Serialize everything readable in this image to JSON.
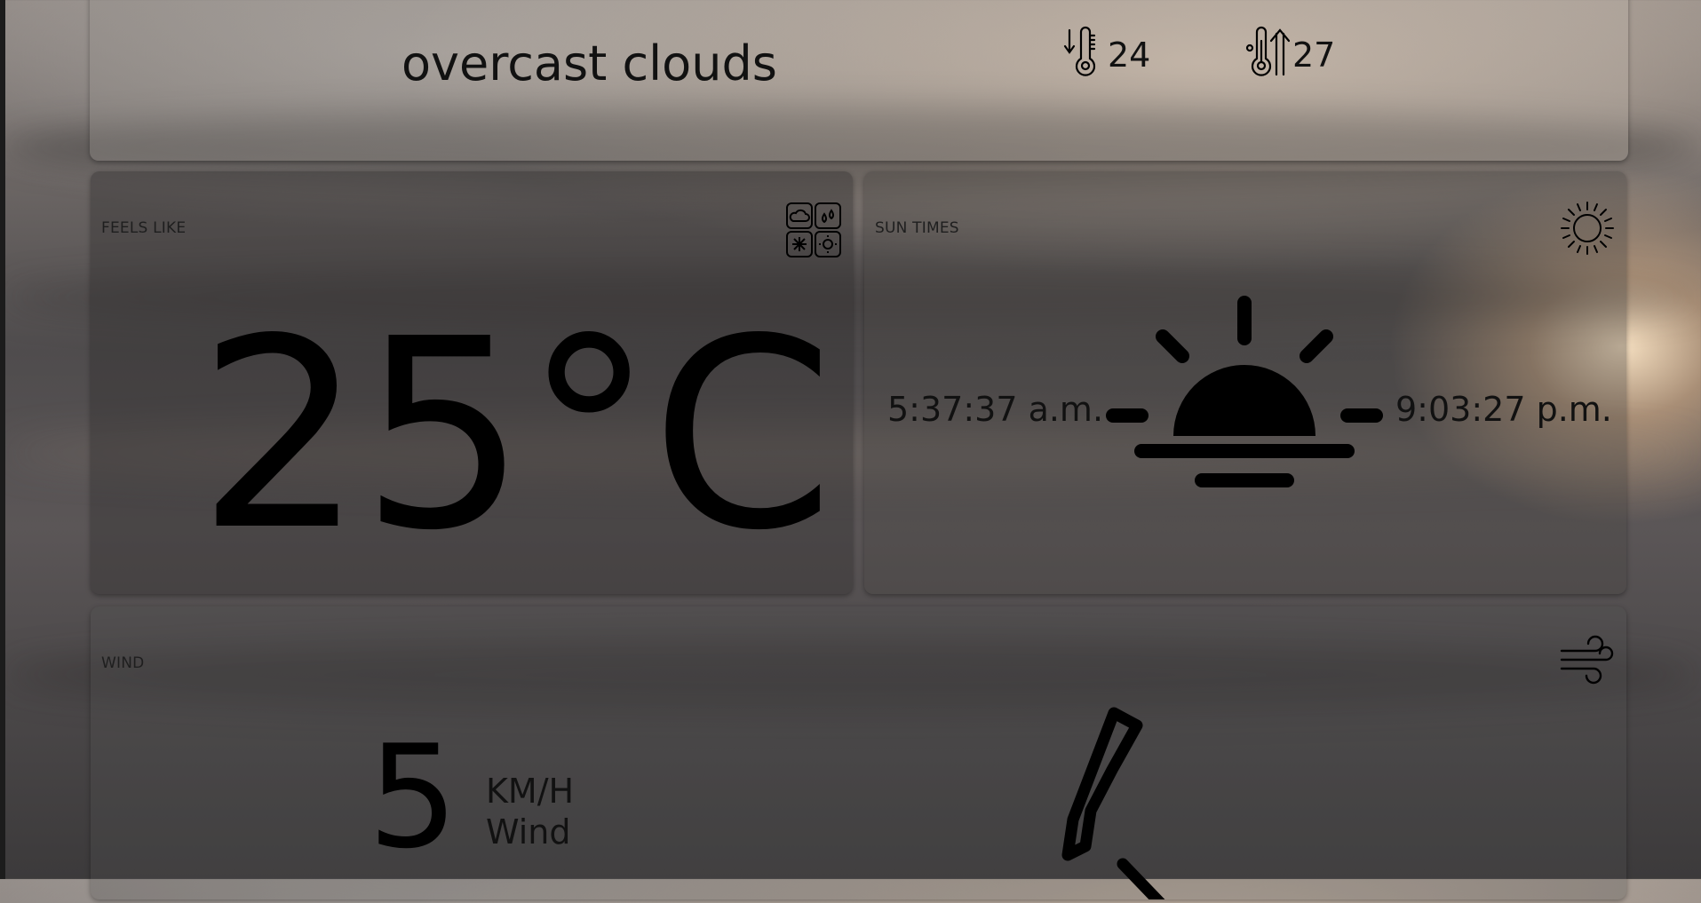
{
  "current": {
    "description": "overcast clouds",
    "temp_min": "24",
    "temp_max": "27"
  },
  "feels_like": {
    "label": "FEELS LIKE",
    "value": "25°C",
    "icon": "weather-conditions-grid-icon"
  },
  "sun_times": {
    "label": "SUN TIMES",
    "sunrise": "5:37:37 a.m.",
    "sunset": "9:03:27 p.m.",
    "icon": "sun-icon"
  },
  "wind": {
    "label": "WIND",
    "speed": "5",
    "unit": "KM/H",
    "unit_label": "Wind",
    "icon": "wind-icon"
  },
  "colors": {
    "text": "#000000",
    "card_bg": "rgba(60,58,58,0.4)"
  }
}
